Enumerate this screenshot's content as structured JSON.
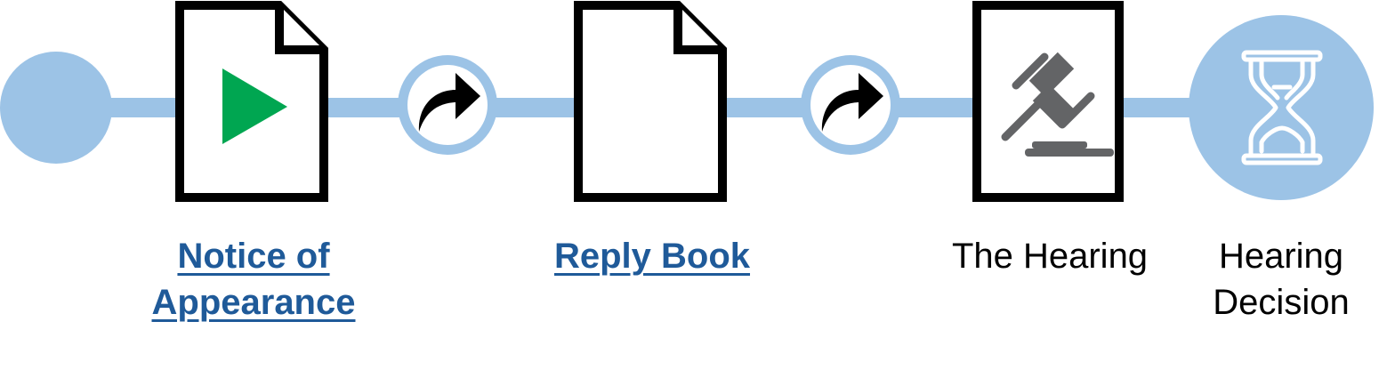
{
  "colors": {
    "track": "#9cc3e6",
    "play": "#00a651",
    "gavel": "#636466",
    "link_text": "#1f5a99",
    "outline": "#000000"
  },
  "steps": [
    {
      "id": "notice",
      "label": "Notice of Appearance",
      "label_line1": "Notice of",
      "label_line2": "Appearance",
      "icon": "play-icon",
      "is_link": true
    },
    {
      "id": "reply",
      "label": "Reply Book",
      "icon": "blank-document-icon",
      "is_link": true
    },
    {
      "id": "hearing",
      "label": "The Hearing",
      "icon": "gavel-icon",
      "is_link": false
    },
    {
      "id": "decision",
      "label": "Hearing Decision",
      "label_line1": "Hearing",
      "label_line2": "Decision",
      "icon": "hourglass-icon",
      "is_link": false
    }
  ],
  "connectors": [
    {
      "icon": "forward-arrow-icon"
    },
    {
      "icon": "forward-arrow-icon"
    }
  ]
}
